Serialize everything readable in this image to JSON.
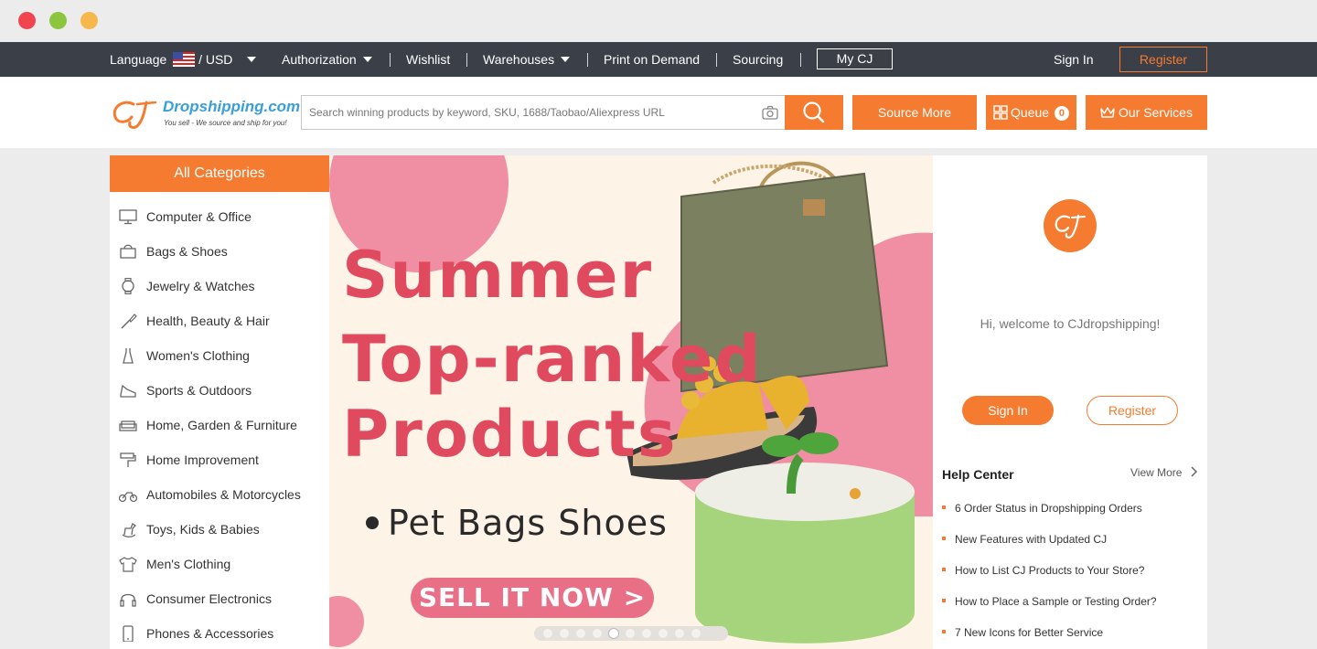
{
  "topbar": {
    "language_label": "Language",
    "currency_label": "/ USD",
    "authorization_label": "Authorization",
    "wishlist_label": "Wishlist",
    "warehouses_label": "Warehouses",
    "print_on_demand_label": "Print on Demand",
    "sourcing_label": "Sourcing",
    "my_cj_label": "My CJ",
    "sign_in_label": "Sign In",
    "register_label": "Register"
  },
  "header": {
    "logo_text": "Dropshipping.com",
    "logo_tagline": "You sell - We source and ship for you!",
    "search_placeholder": "Search winning products by keyword, SKU, 1688/Taobao/Aliexpress URL",
    "source_more_label": "Source More",
    "queue_label": "Queue",
    "queue_count": "0",
    "our_services_label": "Our Services"
  },
  "categories": {
    "title": "All Categories",
    "items": [
      {
        "label": "Computer & Office",
        "icon": "monitor-icon"
      },
      {
        "label": "Bags & Shoes",
        "icon": "bag-icon"
      },
      {
        "label": "Jewelry & Watches",
        "icon": "watch-icon"
      },
      {
        "label": "Health, Beauty & Hair",
        "icon": "brush-icon"
      },
      {
        "label": "Women's Clothing",
        "icon": "dress-icon"
      },
      {
        "label": "Sports & Outdoors",
        "icon": "sneaker-icon"
      },
      {
        "label": "Home, Garden & Furniture",
        "icon": "sofa-icon"
      },
      {
        "label": "Home Improvement",
        "icon": "paint-roller-icon"
      },
      {
        "label": "Automobiles & Motorcycles",
        "icon": "motorcycle-icon"
      },
      {
        "label": "Toys, Kids & Babies",
        "icon": "rocking-horse-icon"
      },
      {
        "label": "Men's Clothing",
        "icon": "shirt-icon"
      },
      {
        "label": "Consumer Electronics",
        "icon": "headphones-icon"
      },
      {
        "label": "Phones & Accessories",
        "icon": "phone-icon"
      }
    ]
  },
  "banner": {
    "title_line1": "Summer",
    "title_line2": "Top-ranked",
    "title_line3": "Products",
    "subtitle": "Pet Bags Shoes",
    "cta_label": "SELL IT NOW >",
    "slide_count": 10,
    "active_slide": 4
  },
  "welcome_panel": {
    "greeting": "Hi, welcome to CJdropshipping!",
    "sign_in_label": "Sign In",
    "register_label": "Register",
    "help_title": "Help Center",
    "view_more_label": "View More",
    "help_items": [
      "6 Order Status in Dropshipping Orders",
      "New Features with Updated CJ",
      "How to List CJ Products to Your Store?",
      "How to Place a Sample or Testing Order?",
      "7 New Icons for Better Service"
    ]
  },
  "colors": {
    "accent": "#f47b2f",
    "topbar": "#3a3f48",
    "banner_title": "#e04a5f",
    "banner_bg": "#fdf3e7"
  }
}
